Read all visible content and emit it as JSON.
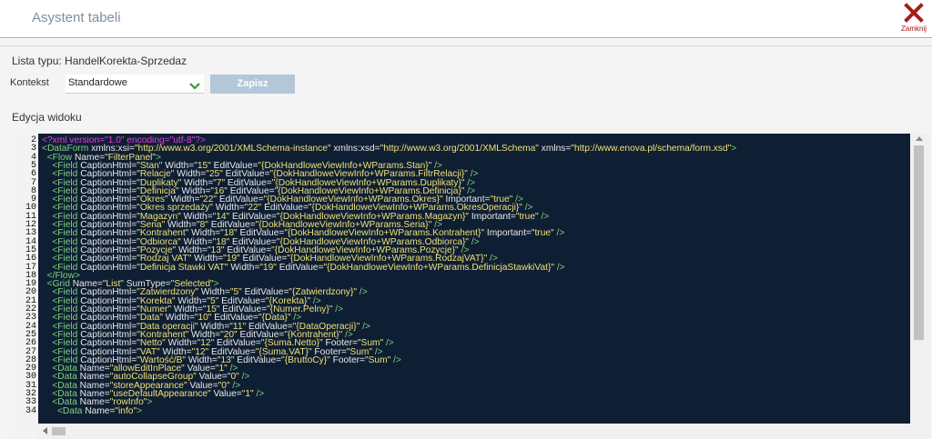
{
  "header": {
    "title": "Asystent tabeli",
    "close_label": "Zamknij"
  },
  "form": {
    "lista_typu": "Lista typu: HandelKorekta-Sprzedaz",
    "kontekst_label": "Kontekst",
    "kontekst_value": "Standardowe",
    "save_label": "Zapisz",
    "edycja_label": "Edycja widoku"
  },
  "editor": {
    "line_numbers": [
      "2",
      "3",
      "4",
      "5",
      "6",
      "7",
      "8",
      "9",
      "10",
      "11",
      "12",
      "13",
      "14",
      "15",
      "16",
      "17",
      "18",
      "19",
      "20",
      "21",
      "22",
      "23",
      "24",
      "25",
      "26",
      "27",
      "28",
      "29",
      "30",
      "31",
      "32",
      "33",
      "34"
    ],
    "lines": [
      [
        [
          "pi",
          "<?xml version=\"1.0\" encoding=\"utf-8\"?>"
        ]
      ],
      [
        [
          "tag",
          "<DataForm "
        ],
        [
          "attr",
          "xmlns:xsi="
        ],
        [
          "val",
          "\"http://www.w3.org/2001/XMLSchema-instance\""
        ],
        [
          "attr",
          " xmlns:xsd="
        ],
        [
          "val",
          "\"http://www.w3.org/2001/XMLSchema\""
        ],
        [
          "attr",
          " xmlns="
        ],
        [
          "val",
          "\"http://www.enova.pl/schema/form.xsd\""
        ],
        [
          "tag",
          ">"
        ]
      ],
      [
        [
          "tag",
          "  <Flow "
        ],
        [
          "attr",
          "Name="
        ],
        [
          "val",
          "\"FilterPanel\""
        ],
        [
          "tag",
          ">"
        ]
      ],
      [
        [
          "tag",
          "    <Field "
        ],
        [
          "attr",
          "CaptionHtml="
        ],
        [
          "val",
          "\"Stan\""
        ],
        [
          "attr",
          " Width="
        ],
        [
          "val",
          "\"15\""
        ],
        [
          "attr",
          " EditValue="
        ],
        [
          "val",
          "\"{DokHandloweViewInfo+WParams.Stan}\""
        ],
        [
          "tag",
          " />"
        ]
      ],
      [
        [
          "tag",
          "    <Field "
        ],
        [
          "attr",
          "CaptionHtml="
        ],
        [
          "val",
          "\"Relacje\""
        ],
        [
          "attr",
          " Width="
        ],
        [
          "val",
          "\"25\""
        ],
        [
          "attr",
          " EditValue="
        ],
        [
          "val",
          "\"{DokHandloweViewInfo+WParams.FiltrRelacji}\""
        ],
        [
          "tag",
          " />"
        ]
      ],
      [
        [
          "tag",
          "    <Field "
        ],
        [
          "attr",
          "CaptionHtml="
        ],
        [
          "val",
          "\"Duplikaty\""
        ],
        [
          "attr",
          " Width="
        ],
        [
          "val",
          "\"7\""
        ],
        [
          "attr",
          " EditValue="
        ],
        [
          "val",
          "\"{DokHandloweViewInfo+WParams.Duplikaty}\""
        ],
        [
          "tag",
          " />"
        ]
      ],
      [
        [
          "tag",
          "    <Field "
        ],
        [
          "attr",
          "CaptionHtml="
        ],
        [
          "val",
          "\"Definicja\""
        ],
        [
          "attr",
          " Width="
        ],
        [
          "val",
          "\"16\""
        ],
        [
          "attr",
          " EditValue="
        ],
        [
          "val",
          "\"{DokHandloweViewInfo+WParams.Definicja}\""
        ],
        [
          "tag",
          " />"
        ]
      ],
      [
        [
          "tag",
          "    <Field "
        ],
        [
          "attr",
          "CaptionHtml="
        ],
        [
          "val",
          "\"Okres\""
        ],
        [
          "attr",
          " Width="
        ],
        [
          "val",
          "\"22\""
        ],
        [
          "attr",
          " EditValue="
        ],
        [
          "val",
          "\"{DokHandloweViewInfo+WParams.Okres}\""
        ],
        [
          "attr",
          " Important="
        ],
        [
          "val",
          "\"true\""
        ],
        [
          "tag",
          " />"
        ]
      ],
      [
        [
          "tag",
          "    <Field "
        ],
        [
          "attr",
          "CaptionHtml="
        ],
        [
          "val",
          "\"Okres sprzedaży\""
        ],
        [
          "attr",
          " Width="
        ],
        [
          "val",
          "\"22\""
        ],
        [
          "attr",
          " EditValue="
        ],
        [
          "val",
          "\"{DokHandloweViewInfo+WParams.OkresOperacji}\""
        ],
        [
          "tag",
          " />"
        ]
      ],
      [
        [
          "tag",
          "    <Field "
        ],
        [
          "attr",
          "CaptionHtml="
        ],
        [
          "val",
          "\"Magazyn\""
        ],
        [
          "attr",
          " Width="
        ],
        [
          "val",
          "\"14\""
        ],
        [
          "attr",
          " EditValue="
        ],
        [
          "val",
          "\"{DokHandloweViewInfo+WParams.Magazyn}\""
        ],
        [
          "attr",
          " Important="
        ],
        [
          "val",
          "\"true\""
        ],
        [
          "tag",
          " />"
        ]
      ],
      [
        [
          "tag",
          "    <Field "
        ],
        [
          "attr",
          "CaptionHtml="
        ],
        [
          "val",
          "\"Seria\""
        ],
        [
          "attr",
          " Width="
        ],
        [
          "val",
          "\"8\""
        ],
        [
          "attr",
          " EditValue="
        ],
        [
          "val",
          "\"{DokHandloweViewInfo+WParams.Seria}\""
        ],
        [
          "tag",
          " />"
        ]
      ],
      [
        [
          "tag",
          "    <Field "
        ],
        [
          "attr",
          "CaptionHtml="
        ],
        [
          "val",
          "\"Kontrahent\""
        ],
        [
          "attr",
          " Width="
        ],
        [
          "val",
          "\"18\""
        ],
        [
          "attr",
          " EditValue="
        ],
        [
          "val",
          "\"{DokHandloweViewInfo+WParams.Kontrahent}\""
        ],
        [
          "attr",
          " Important="
        ],
        [
          "val",
          "\"true\""
        ],
        [
          "tag",
          " />"
        ]
      ],
      [
        [
          "tag",
          "    <Field "
        ],
        [
          "attr",
          "CaptionHtml="
        ],
        [
          "val",
          "\"Odbiorca\""
        ],
        [
          "attr",
          " Width="
        ],
        [
          "val",
          "\"18\""
        ],
        [
          "attr",
          " EditValue="
        ],
        [
          "val",
          "\"{DokHandloweViewInfo+WParams.Odbiorca}\""
        ],
        [
          "tag",
          " />"
        ]
      ],
      [
        [
          "tag",
          "    <Field "
        ],
        [
          "attr",
          "CaptionHtml="
        ],
        [
          "val",
          "\"Pozycje\""
        ],
        [
          "attr",
          " Width="
        ],
        [
          "val",
          "\"13\""
        ],
        [
          "attr",
          " EditValue="
        ],
        [
          "val",
          "\"{DokHandloweViewInfo+WParams.Pozycje}\""
        ],
        [
          "tag",
          " />"
        ]
      ],
      [
        [
          "tag",
          "    <Field "
        ],
        [
          "attr",
          "CaptionHtml="
        ],
        [
          "val",
          "\"Rodzaj VAT\""
        ],
        [
          "attr",
          " Width="
        ],
        [
          "val",
          "\"19\""
        ],
        [
          "attr",
          " EditValue="
        ],
        [
          "val",
          "\"{DokHandloweViewInfo+WParams.RodzajVAT}\""
        ],
        [
          "tag",
          " />"
        ]
      ],
      [
        [
          "tag",
          "    <Field "
        ],
        [
          "attr",
          "CaptionHtml="
        ],
        [
          "val",
          "\"Definicja Stawki VAT\""
        ],
        [
          "attr",
          " Width="
        ],
        [
          "val",
          "\"19\""
        ],
        [
          "attr",
          " EditValue="
        ],
        [
          "val",
          "\"{DokHandloweViewInfo+WParams.DefinicjaStawkiVat}\""
        ],
        [
          "tag",
          " />"
        ]
      ],
      [
        [
          "tag",
          "  </Flow>"
        ]
      ],
      [
        [
          "tag",
          "  <Grid "
        ],
        [
          "attr",
          "Name="
        ],
        [
          "val",
          "\"List\""
        ],
        [
          "attr",
          " SumType="
        ],
        [
          "val",
          "\"Selected\""
        ],
        [
          "tag",
          ">"
        ]
      ],
      [
        [
          "tag",
          "    <Field "
        ],
        [
          "attr",
          "CaptionHtml="
        ],
        [
          "val",
          "\"Zatwierdzony\""
        ],
        [
          "attr",
          " Width="
        ],
        [
          "val",
          "\"5\""
        ],
        [
          "attr",
          " EditValue="
        ],
        [
          "val",
          "\"{Zatwierdzony}\""
        ],
        [
          "tag",
          " />"
        ]
      ],
      [
        [
          "tag",
          "    <Field "
        ],
        [
          "attr",
          "CaptionHtml="
        ],
        [
          "val",
          "\"Korekta\""
        ],
        [
          "attr",
          " Width="
        ],
        [
          "val",
          "\"5\""
        ],
        [
          "attr",
          " EditValue="
        ],
        [
          "val",
          "\"{Korekta}\""
        ],
        [
          "tag",
          " />"
        ]
      ],
      [
        [
          "tag",
          "    <Field "
        ],
        [
          "attr",
          "CaptionHtml="
        ],
        [
          "val",
          "\"Numer\""
        ],
        [
          "attr",
          " Width="
        ],
        [
          "val",
          "\"15\""
        ],
        [
          "attr",
          " EditValue="
        ],
        [
          "val",
          "\"{Numer.Pelny}\""
        ],
        [
          "tag",
          " />"
        ]
      ],
      [
        [
          "tag",
          "    <Field "
        ],
        [
          "attr",
          "CaptionHtml="
        ],
        [
          "val",
          "\"Data\""
        ],
        [
          "attr",
          " Width="
        ],
        [
          "val",
          "\"10\""
        ],
        [
          "attr",
          " EditValue="
        ],
        [
          "val",
          "\"{Data}\""
        ],
        [
          "tag",
          " />"
        ]
      ],
      [
        [
          "tag",
          "    <Field "
        ],
        [
          "attr",
          "CaptionHtml="
        ],
        [
          "val",
          "\"Data operacji\""
        ],
        [
          "attr",
          " Width="
        ],
        [
          "val",
          "\"11\""
        ],
        [
          "attr",
          " EditValue="
        ],
        [
          "val",
          "\"{DataOperacji}\""
        ],
        [
          "tag",
          " />"
        ]
      ],
      [
        [
          "tag",
          "    <Field "
        ],
        [
          "attr",
          "CaptionHtml="
        ],
        [
          "val",
          "\"Kontrahent\""
        ],
        [
          "attr",
          " Width="
        ],
        [
          "val",
          "\"20\""
        ],
        [
          "attr",
          " EditValue="
        ],
        [
          "val",
          "\"{Kontrahent}\""
        ],
        [
          "tag",
          " />"
        ]
      ],
      [
        [
          "tag",
          "    <Field "
        ],
        [
          "attr",
          "CaptionHtml="
        ],
        [
          "val",
          "\"Netto\""
        ],
        [
          "attr",
          " Width="
        ],
        [
          "val",
          "\"12\""
        ],
        [
          "attr",
          " EditValue="
        ],
        [
          "val",
          "\"{Suma.Netto}\""
        ],
        [
          "attr",
          " Footer="
        ],
        [
          "val",
          "\"Sum\""
        ],
        [
          "tag",
          " />"
        ]
      ],
      [
        [
          "tag",
          "    <Field "
        ],
        [
          "attr",
          "CaptionHtml="
        ],
        [
          "val",
          "\"VAT\""
        ],
        [
          "attr",
          " Width="
        ],
        [
          "val",
          "\"12\""
        ],
        [
          "attr",
          " EditValue="
        ],
        [
          "val",
          "\"{Suma.VAT}\""
        ],
        [
          "attr",
          " Footer="
        ],
        [
          "val",
          "\"Sum\""
        ],
        [
          "tag",
          " />"
        ]
      ],
      [
        [
          "tag",
          "    <Field "
        ],
        [
          "attr",
          "CaptionHtml="
        ],
        [
          "val",
          "\"Wartość/B\""
        ],
        [
          "attr",
          " Width="
        ],
        [
          "val",
          "\"13\""
        ],
        [
          "attr",
          " EditValue="
        ],
        [
          "val",
          "\"{BruttoCy}\""
        ],
        [
          "attr",
          " Footer="
        ],
        [
          "val",
          "\"Sum\""
        ],
        [
          "tag",
          " />"
        ]
      ],
      [
        [
          "tag",
          "    <Data "
        ],
        [
          "attr",
          "Name="
        ],
        [
          "val",
          "\"allowEditInPlace\""
        ],
        [
          "attr",
          " Value="
        ],
        [
          "val",
          "\"1\""
        ],
        [
          "tag",
          " />"
        ]
      ],
      [
        [
          "tag",
          "    <Data "
        ],
        [
          "attr",
          "Name="
        ],
        [
          "val",
          "\"autoCollapseGroup\""
        ],
        [
          "attr",
          " Value="
        ],
        [
          "val",
          "\"0\""
        ],
        [
          "tag",
          " />"
        ]
      ],
      [
        [
          "tag",
          "    <Data "
        ],
        [
          "attr",
          "Name="
        ],
        [
          "val",
          "\"storeAppearance\""
        ],
        [
          "attr",
          " Value="
        ],
        [
          "val",
          "\"0\""
        ],
        [
          "tag",
          " />"
        ]
      ],
      [
        [
          "tag",
          "    <Data "
        ],
        [
          "attr",
          "Name="
        ],
        [
          "val",
          "\"useDefaultAppearance\""
        ],
        [
          "attr",
          " Value="
        ],
        [
          "val",
          "\"1\""
        ],
        [
          "tag",
          " />"
        ]
      ],
      [
        [
          "tag",
          "    <Data "
        ],
        [
          "attr",
          "Name="
        ],
        [
          "val",
          "\"rowInfo\""
        ],
        [
          "tag",
          ">"
        ]
      ],
      [
        [
          "tag",
          "      <Data "
        ],
        [
          "attr",
          "Name="
        ],
        [
          "val",
          "\"info\""
        ],
        [
          "tag",
          ">"
        ]
      ]
    ]
  }
}
